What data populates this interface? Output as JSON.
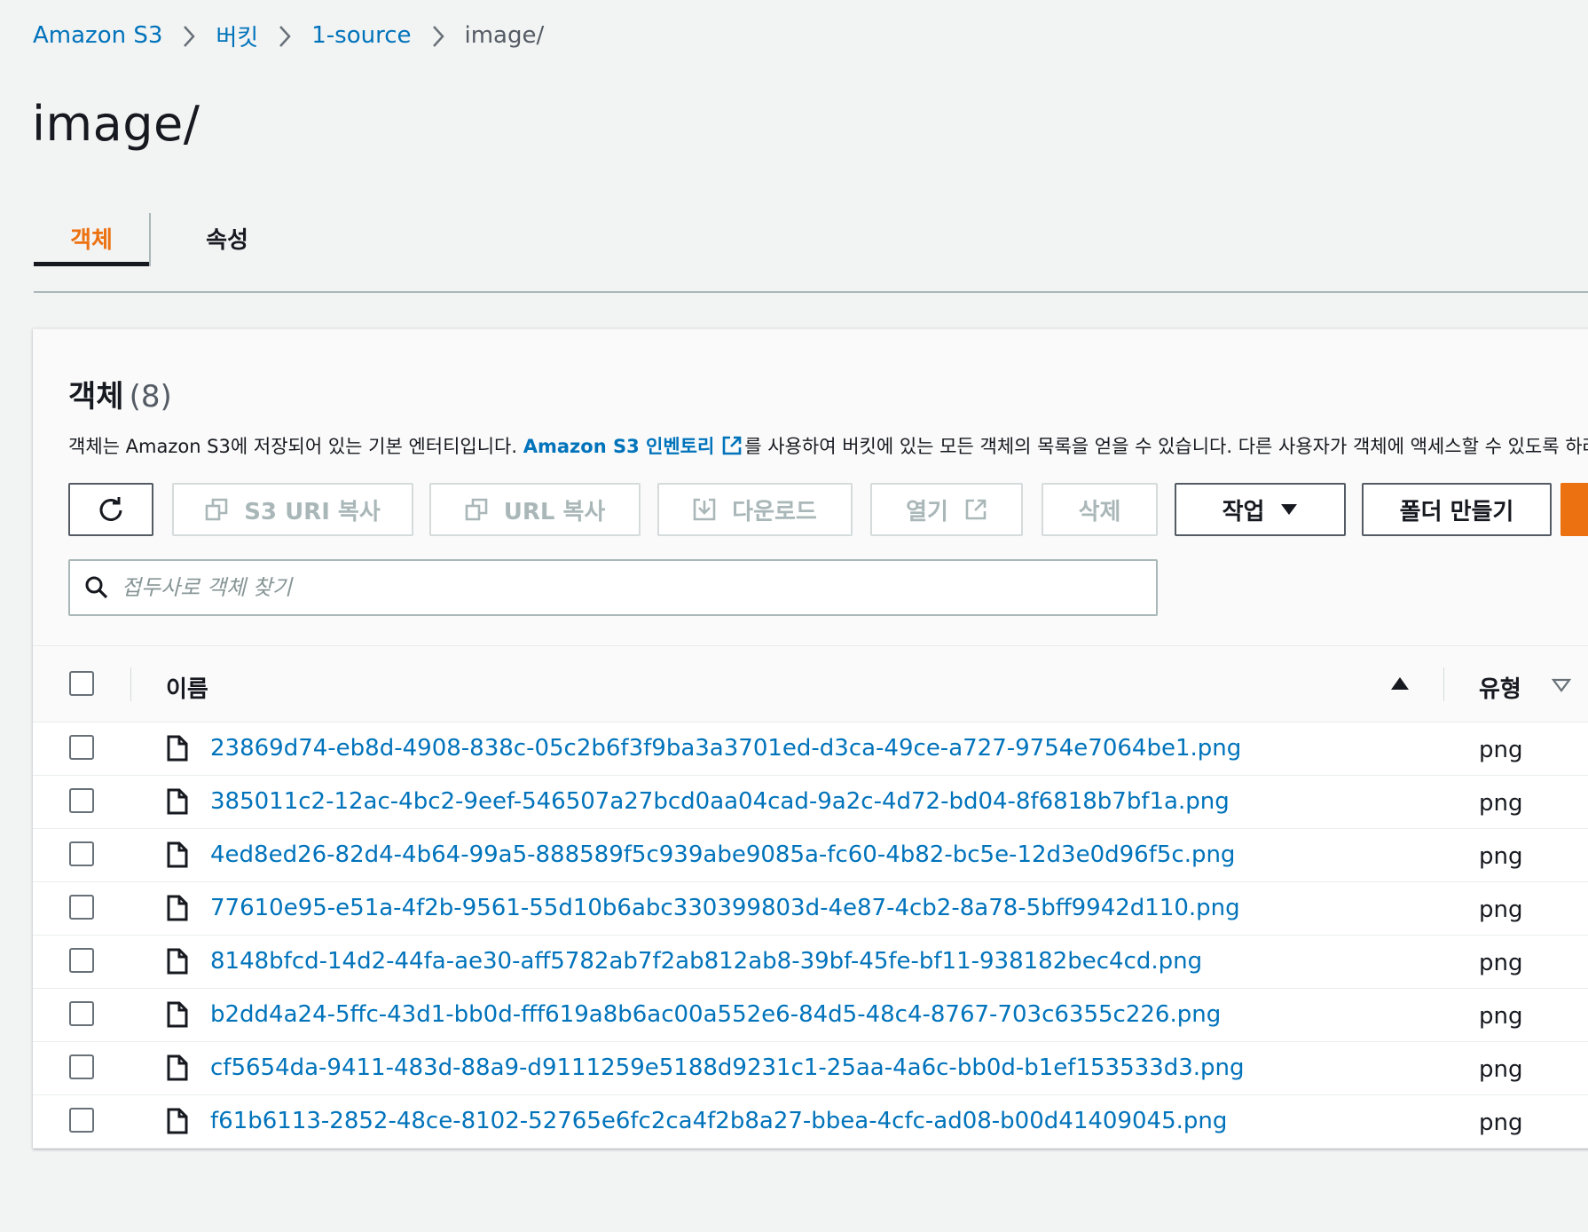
{
  "breadcrumb": {
    "items": [
      "Amazon S3",
      "버킷",
      "1-source"
    ],
    "current": "image/"
  },
  "page_title": "image/",
  "tabs": [
    {
      "label": "객체",
      "active": true
    },
    {
      "label": "속성",
      "active": false
    }
  ],
  "objects_panel": {
    "title": "객체",
    "count": "(8)",
    "description_before": "객체는 Amazon S3에 저장되어 있는 기본 엔터티입니다. ",
    "description_link": "Amazon S3 인벤토리",
    "description_after": "를 사용하여 버킷에 있는 모든 객체의 목록을 얻을 수 있습니다. 다른 사용자가 객체에 액세스할 수 있도록 하려면 명시적으로 권한을 부여해야 합니다."
  },
  "toolbar": {
    "refresh_icon": "refresh-icon",
    "copy_s3_uri": "S3 URI 복사",
    "copy_url": "URL 복사",
    "download": "다운로드",
    "open": "열기",
    "delete": "삭제",
    "actions": "작업",
    "create_folder": "폴더 만들기",
    "disabled_color": "#aab7b8",
    "upload_color": "#ec7211"
  },
  "search": {
    "placeholder": "접두사로 객체 찾기",
    "value": ""
  },
  "table": {
    "columns": [
      "이름",
      "유형"
    ],
    "rows": [
      {
        "name": "23869d74-eb8d-4908-838c-05c2b6f3f9ba3a3701ed-d3ca-49ce-a727-9754e7064be1.png",
        "type": "png"
      },
      {
        "name": "385011c2-12ac-4bc2-9eef-546507a27bcd0aa04cad-9a2c-4d72-bd04-8f6818b7bf1a.png",
        "type": "png"
      },
      {
        "name": "4ed8ed26-82d4-4b64-99a5-888589f5c939abe9085a-fc60-4b82-bc5e-12d3e0d96f5c.png",
        "type": "png"
      },
      {
        "name": "77610e95-e51a-4f2b-9561-55d10b6abc330399803d-4e87-4cb2-8a78-5bff9942d110.png",
        "type": "png"
      },
      {
        "name": "8148bfcd-14d2-44fa-ae30-aff5782ab7f2ab812ab8-39bf-45fe-bf11-938182bec4cd.png",
        "type": "png"
      },
      {
        "name": "b2dd4a24-5ffc-43d1-bb0d-fff619a8b6ac00a552e6-84d5-48c4-8767-703c6355c226.png",
        "type": "png"
      },
      {
        "name": "cf5654da-9411-483d-88a9-d9111259e5188d9231c1-25aa-4a6c-bb0d-b1ef153533d3.png",
        "type": "png"
      },
      {
        "name": "f61b6113-2852-48ce-8102-52765e6fc2ca4f2b8a27-bbea-4cfc-ad08-b00d41409045.png",
        "type": "png"
      }
    ]
  },
  "colors": {
    "link": "#0073bb",
    "accent_orange": "#ec7211",
    "text": "#16191f",
    "background": "#f2f3f3"
  }
}
